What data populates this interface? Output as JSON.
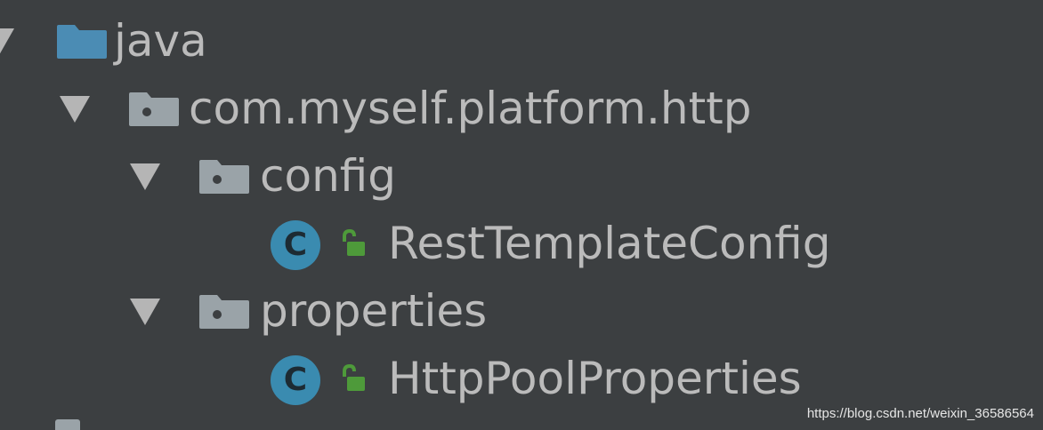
{
  "tree": {
    "java": {
      "label": "java",
      "icon": "source-folder-icon"
    },
    "package": {
      "label": "com.myself.platform.http",
      "icon": "package-icon"
    },
    "config": {
      "label": "config",
      "icon": "package-icon"
    },
    "rest_template_config": {
      "label": "RestTemplateConfig",
      "icon_letter": "C",
      "icon": "class-icon"
    },
    "properties": {
      "label": "properties",
      "icon": "package-icon"
    },
    "http_pool_properties": {
      "label": "HttpPoolProperties",
      "icon_letter": "C",
      "icon": "class-icon"
    }
  },
  "watermark": "https://blog.csdn.net/weixin_36586564",
  "colors": {
    "background": "#3c3f41",
    "text": "#bbbbbb",
    "source_folder": "#4b8cb4",
    "package": "#9aa3a8",
    "class_icon": "#3a8bb0",
    "lock": "#4e9a3a"
  }
}
